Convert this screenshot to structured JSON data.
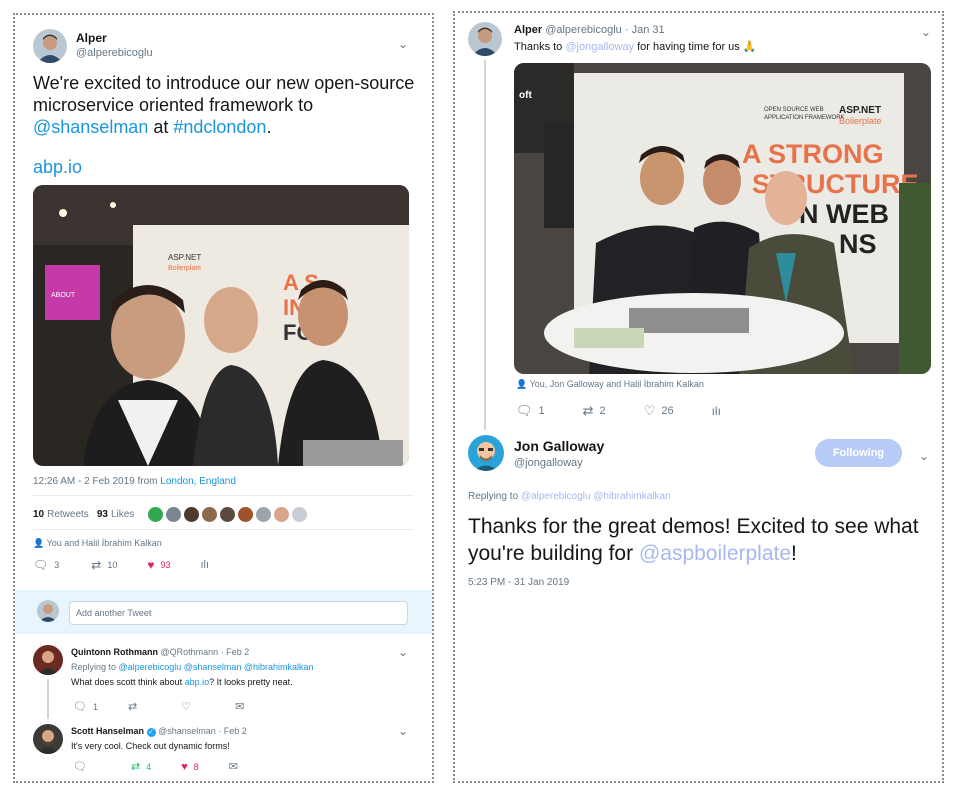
{
  "left": {
    "author": {
      "name": "Alper",
      "handle": "@alperebicoglu"
    },
    "text_main": "We're excited to introduce our new open-source microservice oriented framework to ",
    "mention": "@shanselman",
    "text_at": " at ",
    "hashtag": "#ndclondon",
    "text_end": ".",
    "link": "abp.io",
    "photo_sign_lines": [
      "ASP.NET",
      "Boilerplate",
      "A S",
      "INFR",
      "FO"
    ],
    "timestamp": "12:26 AM - 2 Feb 2019 from ",
    "location": "London, England",
    "stats": {
      "retweets_count": "10",
      "retweets_label": "Retweets",
      "likes_count": "93",
      "likes_label": "Likes"
    },
    "liked_by": "You and Halil İbrahim Kalkan",
    "actions": {
      "reply": "3",
      "retweet": "10",
      "like": "93"
    },
    "reply_placeholder": "Add another Tweet",
    "replies": [
      {
        "name": "Quintonn Rothmann",
        "handle": "@QRothmann",
        "date": "· Feb 2",
        "replying_label": "Replying to ",
        "replying_to": "@alperebicoglu @shanselman @hibrahimkalkan",
        "text_a": "What does scott think about ",
        "text_link": "abp.io",
        "text_b": "? It looks pretty neat.",
        "actions": {
          "reply": "1",
          "retweet": "",
          "like": ""
        }
      },
      {
        "name": "Scott Hanselman",
        "handle": "@shanselman",
        "date": "· Feb 2",
        "text": "It's very cool. Check out dynamic forms!",
        "actions": {
          "reply": "",
          "retweet": "4",
          "like": "8"
        }
      }
    ]
  },
  "right": {
    "author": {
      "name": "Alper",
      "handle": "@alperebicoglu",
      "date": "· Jan 31"
    },
    "text_a": "Thanks to ",
    "mention": "@jongalloway",
    "text_b": " for having time for us ",
    "emoji": "🙏",
    "photo_sign_lines": [
      "OPEN SOURCE WEB",
      "APPLICATION FRAMEWORK",
      "ASP.NET",
      "Boilerplate",
      "A STRONG",
      "STRUCTURE",
      "N WEB",
      "NS",
      "oft"
    ],
    "tagged": "You, Jon Galloway and Halil İbrahim Kalkan",
    "actions": {
      "reply": "1",
      "retweet": "2",
      "like": "26"
    },
    "reply_author": {
      "name": "Jon Galloway",
      "handle": "@jongalloway"
    },
    "follow_label": "Following",
    "replying_label": "Replying to ",
    "replying_to": "@alperebicoglu @hibrahimkalkan",
    "reply_text_a": "Thanks for the great demos! Excited to see what you're building for ",
    "reply_mention": "@aspboilerplate",
    "reply_text_b": "!",
    "reply_time": "5:23 PM - 31 Jan 2019"
  },
  "colors": {
    "link": "#1b95e0",
    "like": "#e0245e",
    "retweet": "#17bf63",
    "follow_bg": "#b7ccf6"
  }
}
